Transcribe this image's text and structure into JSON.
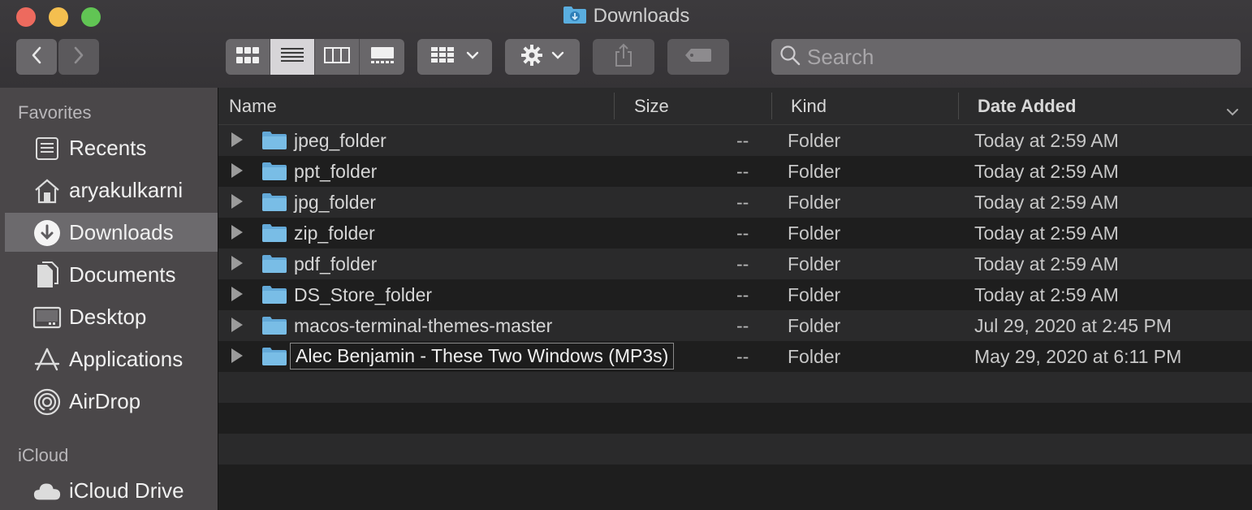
{
  "window": {
    "title": "Downloads"
  },
  "toolbar": {
    "back_icon": "chevron-left-icon",
    "forward_icon": "chevron-right-icon",
    "view_modes": [
      "icon-view",
      "list-view",
      "column-view",
      "gallery-view"
    ],
    "active_view": "list-view",
    "search_placeholder": "Search"
  },
  "sidebar": {
    "favorites_heading": "Favorites",
    "favorites": [
      {
        "label": "Recents",
        "icon": "recents-icon",
        "selected": false
      },
      {
        "label": "aryakulkarni",
        "icon": "home-icon",
        "selected": false
      },
      {
        "label": "Downloads",
        "icon": "downloads-icon",
        "selected": true
      },
      {
        "label": "Documents",
        "icon": "documents-icon",
        "selected": false
      },
      {
        "label": "Desktop",
        "icon": "desktop-icon",
        "selected": false
      },
      {
        "label": "Applications",
        "icon": "applications-icon",
        "selected": false
      },
      {
        "label": "AirDrop",
        "icon": "airdrop-icon",
        "selected": false
      }
    ],
    "icloud_heading": "iCloud",
    "icloud": [
      {
        "label": "iCloud Drive",
        "icon": "cloud-icon",
        "selected": false
      }
    ]
  },
  "columns": {
    "name": "Name",
    "size": "Size",
    "kind": "Kind",
    "date_added": "Date Added"
  },
  "files": [
    {
      "name": "jpeg_folder",
      "size": "--",
      "kind": "Folder",
      "date_added": "Today at 2:59 AM"
    },
    {
      "name": "ppt_folder",
      "size": "--",
      "kind": "Folder",
      "date_added": "Today at 2:59 AM"
    },
    {
      "name": "jpg_folder",
      "size": "--",
      "kind": "Folder",
      "date_added": "Today at 2:59 AM"
    },
    {
      "name": "zip_folder",
      "size": "--",
      "kind": "Folder",
      "date_added": "Today at 2:59 AM"
    },
    {
      "name": "pdf_folder",
      "size": "--",
      "kind": "Folder",
      "date_added": "Today at 2:59 AM"
    },
    {
      "name": "DS_Store_folder",
      "size": "--",
      "kind": "Folder",
      "date_added": "Today at 2:59 AM"
    },
    {
      "name": "macos-terminal-themes-master",
      "size": "--",
      "kind": "Folder",
      "date_added": "Jul 29, 2020 at 2:45 PM"
    },
    {
      "name": "Alec Benjamin - These Two Windows (MP3s)",
      "size": "--",
      "kind": "Folder",
      "date_added": "May 29, 2020 at 6:11 PM",
      "renaming": true
    }
  ]
}
